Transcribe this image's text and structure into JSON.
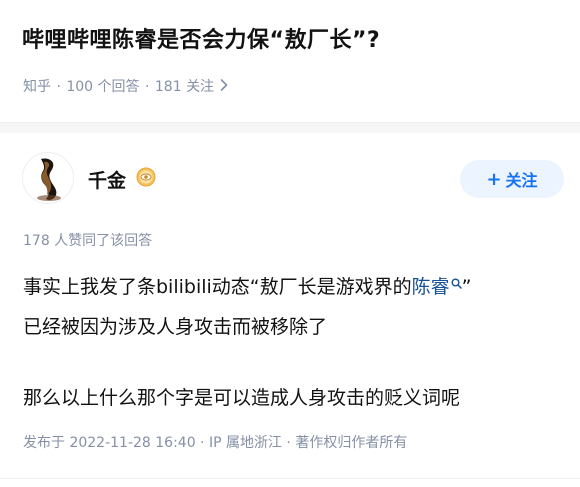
{
  "question": {
    "title": "哔哩哔哩陈睿是否会力保“敖厂长”?",
    "source": "知乎",
    "answers": "100 个回答",
    "followers": "181 关注",
    "chevron_icon": "chevron-right-icon"
  },
  "answer": {
    "author": {
      "name": "千金",
      "avatar_icon": "avatar-figure",
      "badge_icon": "eye-badge-icon"
    },
    "follow_label": "关注",
    "follow_plus": "+",
    "votes": "178 人赞同了该回答",
    "content": {
      "p1_before": "事实上我发了条bilibili动态“敖厂长是游戏界的",
      "p1_link": "陈睿",
      "p1_after": "”",
      "p2": "已经被因为涉及人身攻击而被移除了",
      "p3": "那么以上什么那个字是可以造成人身攻击的贬义词呢"
    },
    "published": "发布于 2022-11-28 16:40 · IP 属地浙江 · 著作权归作者所有"
  },
  "colors": {
    "text": "#121212",
    "meta": "#8590a6",
    "link": "#175199",
    "follow_bg": "#ebf4ff",
    "follow_text": "#1772f6"
  }
}
